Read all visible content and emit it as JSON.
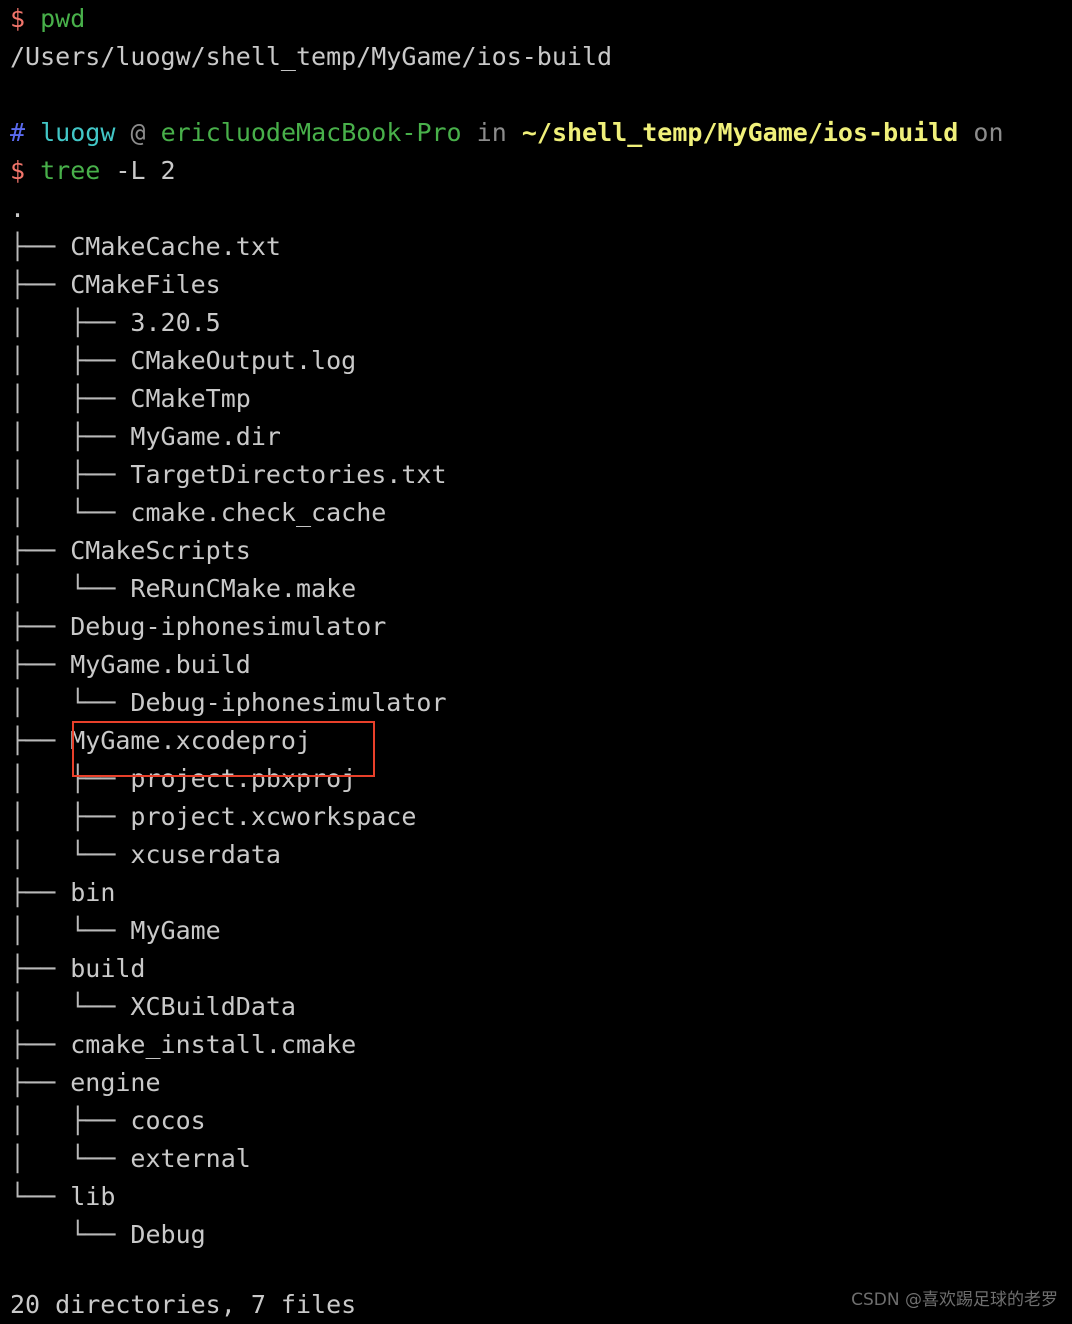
{
  "terminal": {
    "background": "#000000",
    "foreground": "#c9c9c9",
    "prompt_symbol_dollar": "$",
    "prompt_symbol_hash": "#"
  },
  "command_1": {
    "sigil": "$",
    "command": "pwd",
    "output": "/Users/luogw/shell_temp/MyGame/ios-build"
  },
  "prompt_line": {
    "sigil": "#",
    "user": "luogw",
    "at": "@",
    "host": "ericluodeMacBook-Pro",
    "in_keyword": "in",
    "cwd": "~/shell_temp/MyGame/ios-build",
    "trailing_keyword": "on"
  },
  "command_2": {
    "sigil": "$",
    "command": "tree",
    "args": "-L 2"
  },
  "tree": {
    "root": ".",
    "rows": [
      {
        "prefix": "├── ",
        "name": "CMakeCache.txt"
      },
      {
        "prefix": "├── ",
        "name": "CMakeFiles"
      },
      {
        "prefix": "│   ├── ",
        "name": "3.20.5"
      },
      {
        "prefix": "│   ├── ",
        "name": "CMakeOutput.log"
      },
      {
        "prefix": "│   ├── ",
        "name": "CMakeTmp"
      },
      {
        "prefix": "│   ├── ",
        "name": "MyGame.dir"
      },
      {
        "prefix": "│   ├── ",
        "name": "TargetDirectories.txt"
      },
      {
        "prefix": "│   └── ",
        "name": "cmake.check_cache"
      },
      {
        "prefix": "├── ",
        "name": "CMakeScripts"
      },
      {
        "prefix": "│   └── ",
        "name": "ReRunCMake.make"
      },
      {
        "prefix": "├── ",
        "name": "Debug-iphonesimulator"
      },
      {
        "prefix": "├── ",
        "name": "MyGame.build"
      },
      {
        "prefix": "│   └── ",
        "name": "Debug-iphonesimulator"
      },
      {
        "prefix": "├── ",
        "name": "MyGame.xcodeproj"
      },
      {
        "prefix": "│   ├── ",
        "name": "project.pbxproj"
      },
      {
        "prefix": "│   ├── ",
        "name": "project.xcworkspace"
      },
      {
        "prefix": "│   └── ",
        "name": "xcuserdata"
      },
      {
        "prefix": "├── ",
        "name": "bin"
      },
      {
        "prefix": "│   └── ",
        "name": "MyGame"
      },
      {
        "prefix": "├── ",
        "name": "build"
      },
      {
        "prefix": "│   └── ",
        "name": "XCBuildData"
      },
      {
        "prefix": "├── ",
        "name": "cmake_install.cmake"
      },
      {
        "prefix": "├── ",
        "name": "engine"
      },
      {
        "prefix": "│   ├── ",
        "name": "cocos"
      },
      {
        "prefix": "│   └── ",
        "name": "external"
      },
      {
        "prefix": "└── ",
        "name": "lib"
      },
      {
        "prefix": "    └── ",
        "name": "Debug"
      }
    ]
  },
  "summary": "20 directories, 7 files",
  "annotation": {
    "color": "#e8402a",
    "target": "MyGame.xcodeproj"
  },
  "watermark": {
    "text": "CSDN @喜欢踢足球的老罗"
  }
}
